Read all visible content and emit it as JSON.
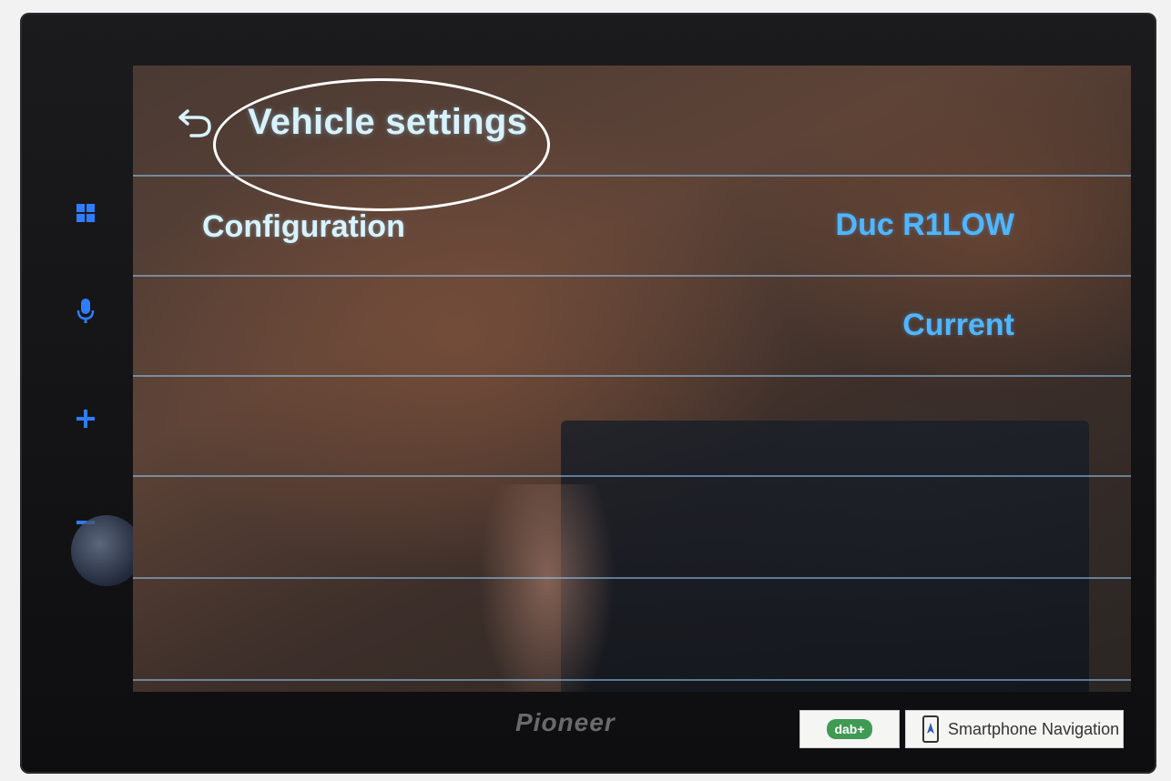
{
  "header": {
    "title": "Vehicle settings"
  },
  "rows": [
    {
      "label": "Configuration",
      "value": "Duc R1LOW"
    },
    {
      "label": "",
      "value": "Current"
    }
  ],
  "device": {
    "brand": "Pioneer",
    "dab_logo": "dab+",
    "nav_sticker": "Smartphone Navigation"
  },
  "side_buttons": [
    "home-grid-icon",
    "mic-icon",
    "plus-icon",
    "minus-icon"
  ],
  "colors": {
    "title_text": "#d8f3ff",
    "value_text": "#4fb6ff",
    "separator": "#96c8f0",
    "side_icon": "#2f7dff",
    "annotation": "#ffffff"
  }
}
